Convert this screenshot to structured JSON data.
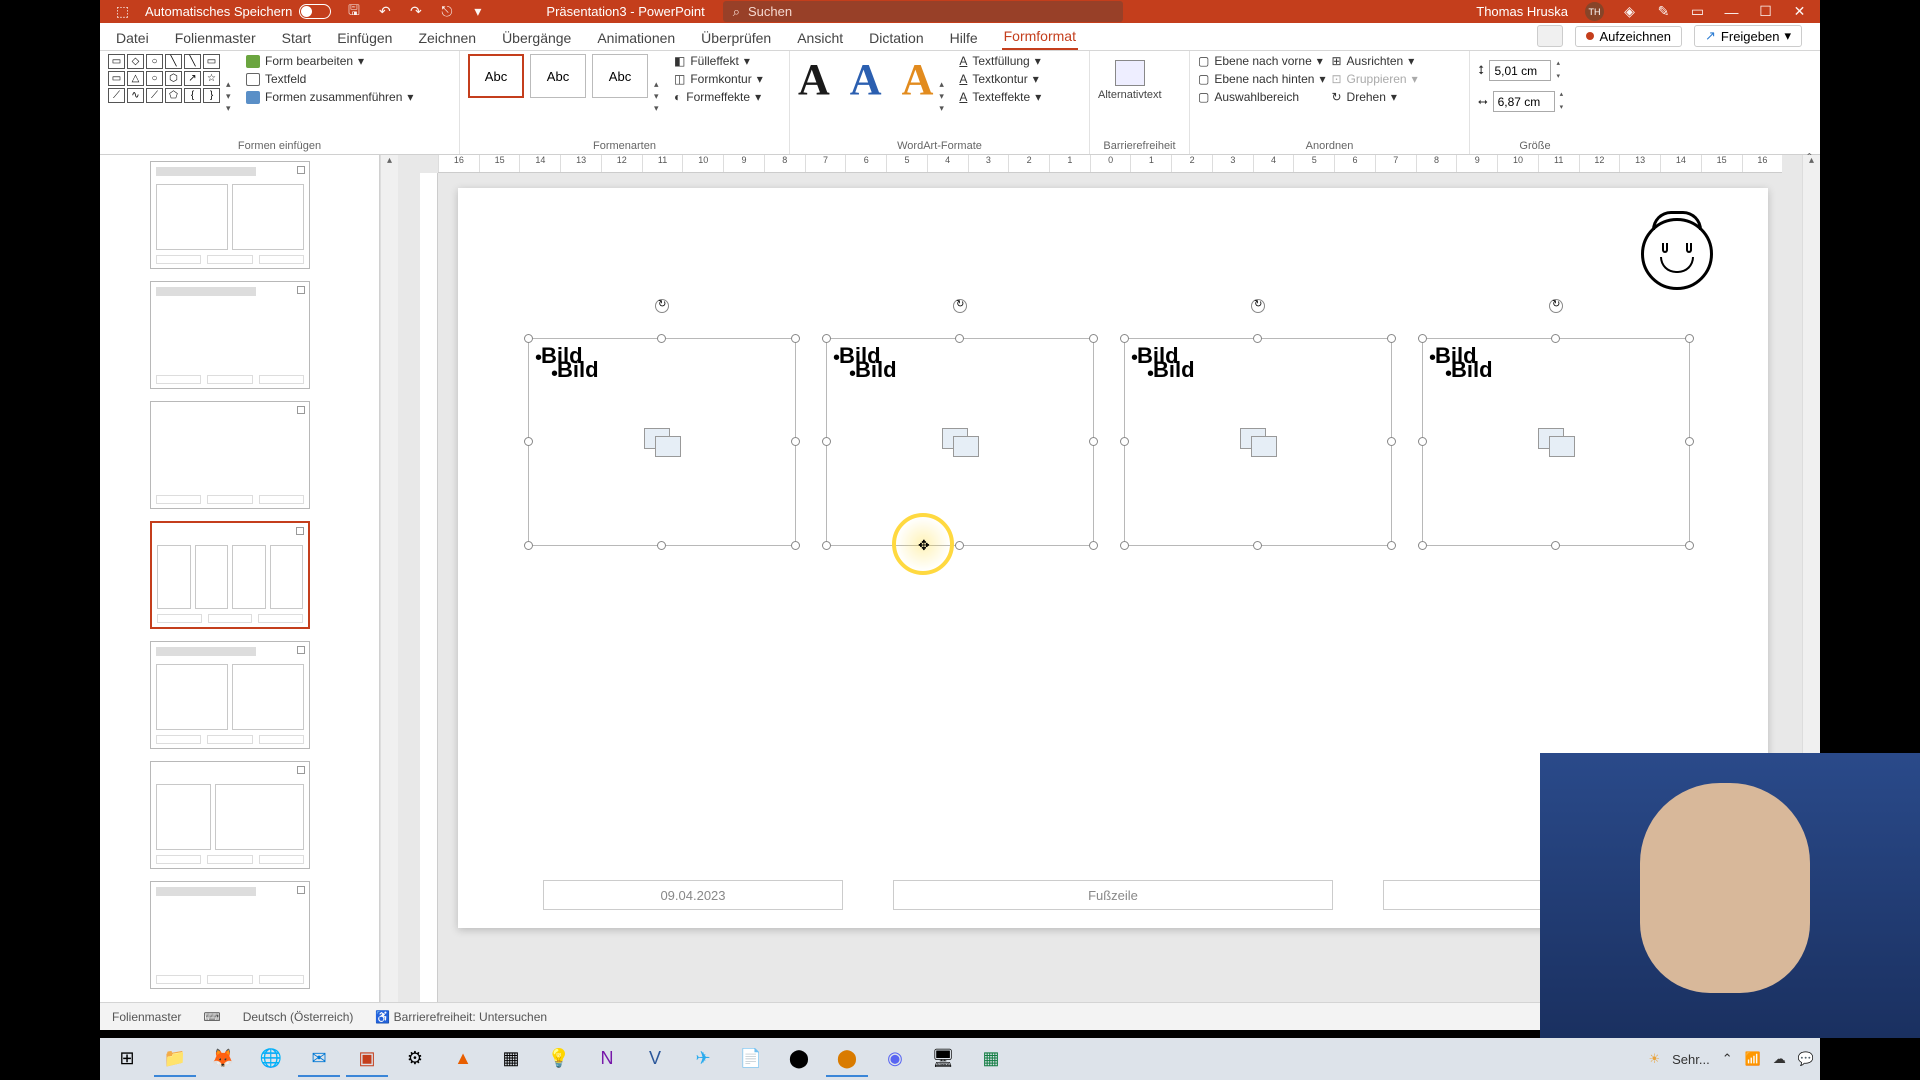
{
  "title": {
    "autosave": "Automatisches Speichern",
    "doc": "Präsentation3",
    "app": "PowerPoint",
    "search_ph": "Suchen",
    "user": "Thomas Hruska",
    "initials": "TH"
  },
  "tabs": {
    "items": [
      "Datei",
      "Folienmaster",
      "Start",
      "Einfügen",
      "Zeichnen",
      "Übergänge",
      "Animationen",
      "Überprüfen",
      "Ansicht",
      "Dictation",
      "Hilfe",
      "Formformat"
    ],
    "active": 11,
    "record": "Aufzeichnen",
    "share": "Freigeben"
  },
  "ribbon": {
    "g1": {
      "edit": "Form bearbeiten",
      "text": "Textfeld",
      "merge": "Formen zusammenführen",
      "label": "Formen einfügen"
    },
    "g2": {
      "abc": "Abc",
      "fill": "Fülleffekt",
      "outline": "Formkontur",
      "effects": "Formeffekte",
      "label": "Formenarten"
    },
    "g3": {
      "tfill": "Textfüllung",
      "toutline": "Textkontur",
      "teffects": "Texteffekte",
      "label": "WordArt-Formate"
    },
    "g4": {
      "alt": "Alternativtext",
      "label": "Barrierefreiheit"
    },
    "g5": {
      "front": "Ebene nach vorne",
      "back": "Ebene nach hinten",
      "sel": "Auswahlbereich",
      "align": "Ausrichten",
      "group": "Gruppieren",
      "rotate": "Drehen",
      "label": "Anordnen"
    },
    "g6": {
      "h": "5,01 cm",
      "w": "6,87 cm",
      "label": "Größe"
    }
  },
  "ruler": [
    "16",
    "15",
    "14",
    "13",
    "12",
    "11",
    "10",
    "9",
    "8",
    "7",
    "6",
    "5",
    "4",
    "3",
    "2",
    "1",
    "0",
    "1",
    "2",
    "3",
    "4",
    "5",
    "6",
    "7",
    "8",
    "9",
    "10",
    "11",
    "12",
    "13",
    "14",
    "15",
    "16"
  ],
  "slide": {
    "ph_label": "Bild",
    "date": "09.04.2023",
    "footer": "Fußzeile"
  },
  "status": {
    "view": "Folienmaster",
    "lang": "Deutsch (Österreich)",
    "acc": "Barrierefreiheit: Untersuchen"
  },
  "tray": {
    "weather": "Sehr..."
  }
}
